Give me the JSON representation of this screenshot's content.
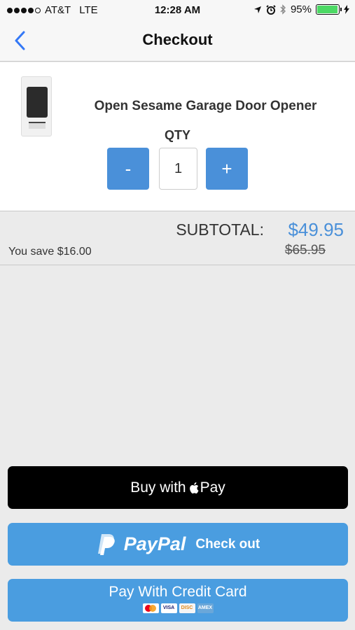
{
  "status_bar": {
    "carrier": "AT&T",
    "network": "LTE",
    "time": "12:28 AM",
    "battery_percent": "95%",
    "battery_level": 0.95
  },
  "nav": {
    "title": "Checkout"
  },
  "product": {
    "name": "Open Sesame Garage Door Opener",
    "qty_label": "QTY",
    "qty_value": "1",
    "minus_label": "-",
    "plus_label": "+"
  },
  "summary": {
    "subtotal_label": "SUBTOTAL:",
    "subtotal_price": "$49.95",
    "original_price": "$65.95",
    "savings": "You save $16.00"
  },
  "payment": {
    "apple_pay_prefix": "Buy with",
    "apple_pay_suffix": "Pay",
    "paypal_word": "PayPal",
    "paypal_checkout": "Check out",
    "credit_card_label": "Pay With Credit Card",
    "card_logos": [
      "mastercard-icon",
      "visa-icon",
      "discover-icon",
      "amex-icon"
    ]
  },
  "colors": {
    "accent": "#4a90d9",
    "paypal_blue": "#4a9de0",
    "apple_pay_bg": "#000000",
    "battery_green": "#4cd964"
  }
}
